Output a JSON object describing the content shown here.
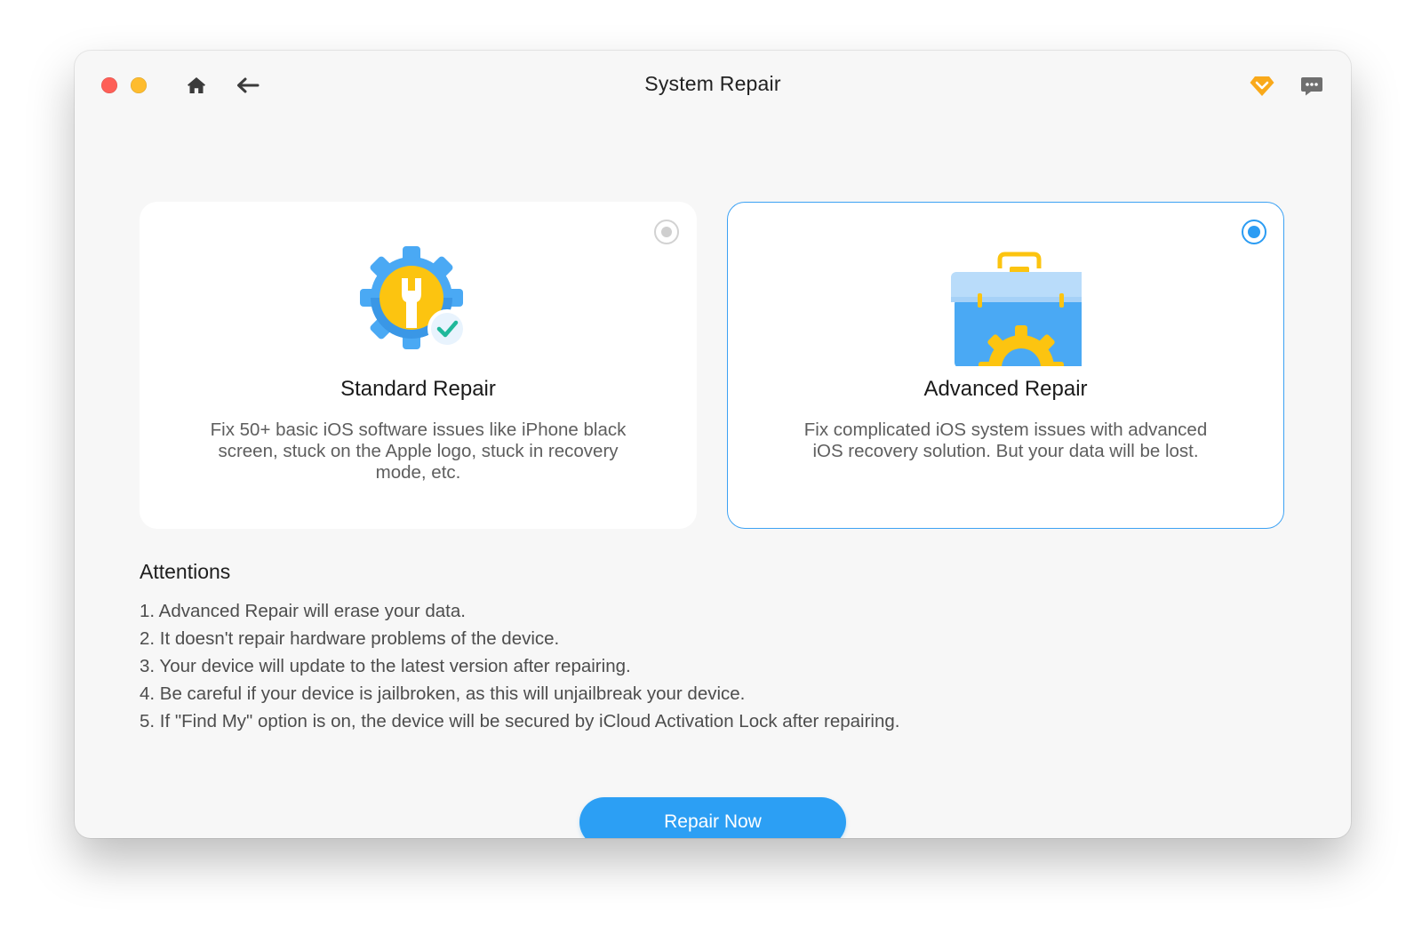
{
  "window": {
    "title": "System Repair"
  },
  "icons": {
    "home": "home-icon",
    "back": "arrow-left-icon",
    "premium": "diamond-icon",
    "feedback": "chat-bubble-icon"
  },
  "colors": {
    "accent": "#2c9ff4",
    "selected_border": "#3da2f4",
    "traffic_close": "#fe5f57",
    "traffic_minimize": "#febc2e",
    "premium_icon": "#f9a91a"
  },
  "modes": [
    {
      "id": "standard",
      "title": "Standard Repair",
      "description": "Fix 50+ basic iOS software issues like iPhone black screen, stuck on the Apple logo, stuck in recovery mode, etc.",
      "selected": false,
      "icon": "gear-wrench-check-icon"
    },
    {
      "id": "advanced",
      "title": "Advanced Repair",
      "description": "Fix complicated iOS system issues with advanced iOS recovery solution. But your data will be lost.",
      "selected": true,
      "icon": "toolbox-gear-icon"
    }
  ],
  "attentions": {
    "title": "Attentions",
    "items": [
      "1. Advanced Repair will erase your data.",
      "2. It doesn't repair hardware problems of the device.",
      "3. Your device will update to the latest version after repairing.",
      "4. Be careful if your device is jailbroken, as this will unjailbreak your device.",
      "5. If \"Find My\" option is on, the device will be secured by iCloud Activation Lock after repairing."
    ]
  },
  "actions": {
    "repair_now": "Repair Now"
  }
}
